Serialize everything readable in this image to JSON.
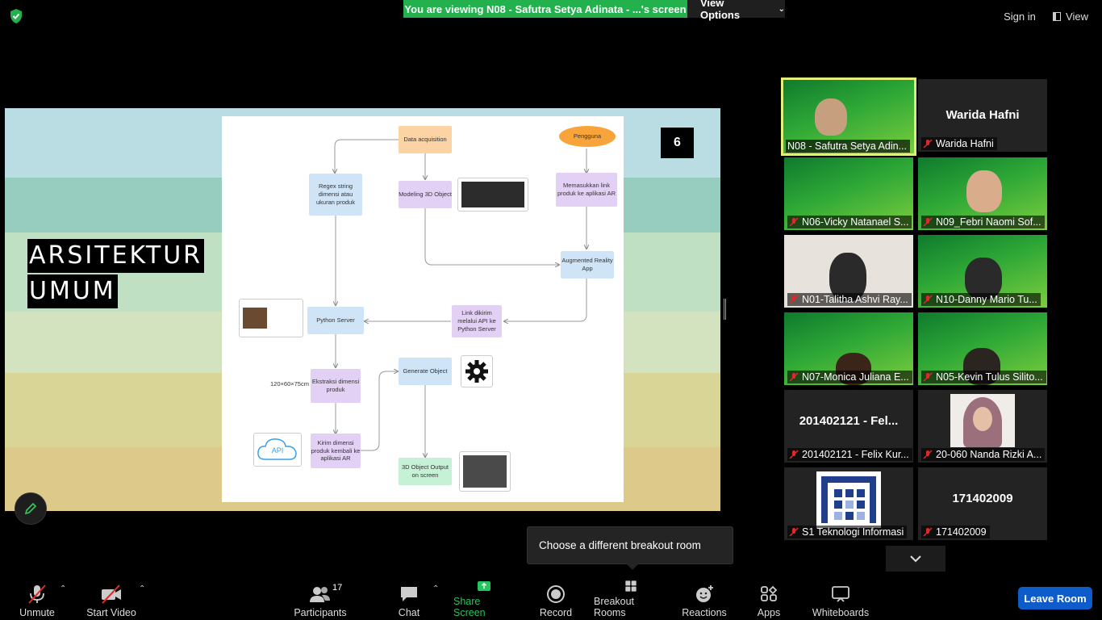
{
  "top": {
    "viewing_banner": "You are viewing N08 - Safutra Setya Adinata - ...'s screen",
    "view_options": "View Options",
    "sign_in": "Sign in",
    "view": "View"
  },
  "slide": {
    "title_line1": "ARSITEKTUR",
    "title_line2": "UMUM",
    "number": "6",
    "diagram": {
      "data_acquisition": "Data acquisition",
      "pengguna": "Pengguna",
      "regex": "Regex string dimensi atau ukuran produk",
      "modeling": "Modeling 3D Object",
      "memasukkan": "Memasukkan link produk ke aplikasi AR",
      "ar_app": "Augmented Reality App",
      "python_server": "Python Server",
      "link_dikirim": "Link dikirim melalui API ke Python Server",
      "ekstraksi": "Ekstraksi dimensi produk",
      "dimension_text": "120×60×75cm",
      "generate": "Generate Object",
      "kirim": "Kirim dimensi produk kembali ke aplikasi AR",
      "output": "3D Object Output on screen",
      "api_label": "API"
    }
  },
  "gallery": {
    "tiles": [
      {
        "name": "N08 - Safutra Setya Adin...",
        "big": ""
      },
      {
        "name": "Warida Hafni",
        "big": "Warida Hafni"
      },
      {
        "name": "N06-Vicky Natanael S...",
        "big": ""
      },
      {
        "name": "N09_Febri Naomi Sof...",
        "big": ""
      },
      {
        "name": "N01-Talitha Ashvi Ray...",
        "big": ""
      },
      {
        "name": "N10-Danny Mario Tu...",
        "big": ""
      },
      {
        "name": "N07-Monica Juliana E...",
        "big": ""
      },
      {
        "name": "N05-Kevin Tulus Silito...",
        "big": ""
      },
      {
        "name": "201402121 - Felix Kur...",
        "big": "201402121 - Fel..."
      },
      {
        "name": "20-060 Nanda Rizki A...",
        "big": ""
      },
      {
        "name": "S1 Teknologi Informasi",
        "big": ""
      },
      {
        "name": "171402009",
        "big": "171402009"
      }
    ]
  },
  "tooltip": "Choose a different breakout room",
  "toolbar": {
    "unmute": "Unmute",
    "start_video": "Start Video",
    "participants": "Participants",
    "participant_count": "17",
    "chat": "Chat",
    "share_screen": "Share Screen",
    "record": "Record",
    "breakout_rooms": "Breakout Rooms",
    "reactions": "Reactions",
    "apps": "Apps",
    "whiteboards": "Whiteboards",
    "leave_room": "Leave Room"
  },
  "colors": {
    "banner_green": "#22b14c",
    "share_green": "#22c55e",
    "leave_blue": "#0e5cc9",
    "active_speaker": "#e1f07a",
    "muted_red": "#e02828"
  }
}
